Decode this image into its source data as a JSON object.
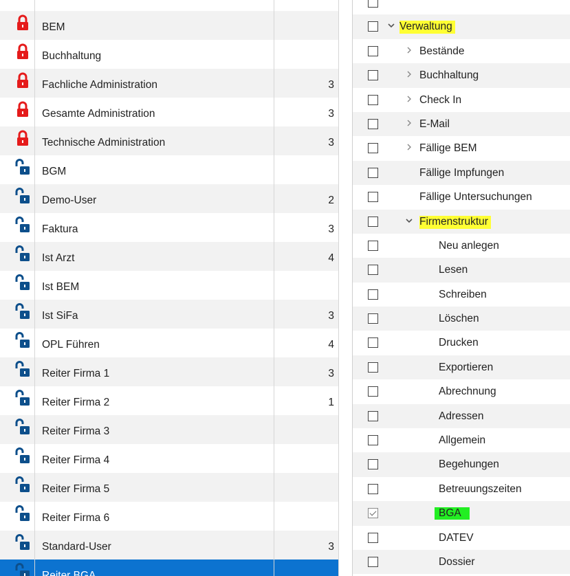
{
  "colors": {
    "selection": "#0c73d0",
    "lock_locked": "#e51b1b",
    "lock_unlocked": "#0d4f8b",
    "highlight_yellow": "#ffff33",
    "highlight_green": "#22ee22"
  },
  "roles": [
    {
      "name": "BEM",
      "count": "",
      "locked": true,
      "selected": false
    },
    {
      "name": "Buchhaltung",
      "count": "",
      "locked": true,
      "selected": false
    },
    {
      "name": "Fachliche Administration",
      "count": "3",
      "locked": true,
      "selected": false
    },
    {
      "name": "Gesamte Administration",
      "count": "3",
      "locked": true,
      "selected": false
    },
    {
      "name": "Technische Administration",
      "count": "3",
      "locked": true,
      "selected": false
    },
    {
      "name": "BGM",
      "count": "",
      "locked": false,
      "selected": false
    },
    {
      "name": "Demo-User",
      "count": "2",
      "locked": false,
      "selected": false
    },
    {
      "name": "Faktura",
      "count": "3",
      "locked": false,
      "selected": false
    },
    {
      "name": "Ist Arzt",
      "count": "4",
      "locked": false,
      "selected": false
    },
    {
      "name": "Ist BEM",
      "count": "",
      "locked": false,
      "selected": false
    },
    {
      "name": "Ist SiFa",
      "count": "3",
      "locked": false,
      "selected": false
    },
    {
      "name": "OPL Führen",
      "count": "4",
      "locked": false,
      "selected": false
    },
    {
      "name": "Reiter Firma 1",
      "count": "3",
      "locked": false,
      "selected": false
    },
    {
      "name": "Reiter Firma 2",
      "count": "1",
      "locked": false,
      "selected": false
    },
    {
      "name": "Reiter Firma 3",
      "count": "",
      "locked": false,
      "selected": false
    },
    {
      "name": "Reiter Firma 4",
      "count": "",
      "locked": false,
      "selected": false
    },
    {
      "name": "Reiter Firma 5",
      "count": "",
      "locked": false,
      "selected": false
    },
    {
      "name": "Reiter Firma 6",
      "count": "",
      "locked": false,
      "selected": false
    },
    {
      "name": "Standard-User",
      "count": "3",
      "locked": false,
      "selected": false
    },
    {
      "name": "Reiter BGA",
      "count": "",
      "locked": false,
      "selected": true
    }
  ],
  "permissions": [
    {
      "label": "",
      "level": 0,
      "expander": "none",
      "checked": false,
      "highlight": "none"
    },
    {
      "label": "Verwaltung",
      "level": 0,
      "expander": "expanded",
      "checked": false,
      "highlight": "yellow"
    },
    {
      "label": "Bestände",
      "level": 1,
      "expander": "collapsed",
      "checked": false,
      "highlight": "none"
    },
    {
      "label": "Buchhaltung",
      "level": 1,
      "expander": "collapsed",
      "checked": false,
      "highlight": "none"
    },
    {
      "label": "Check In",
      "level": 1,
      "expander": "collapsed",
      "checked": false,
      "highlight": "none"
    },
    {
      "label": "E-Mail",
      "level": 1,
      "expander": "collapsed",
      "checked": false,
      "highlight": "none"
    },
    {
      "label": "Fällige BEM",
      "level": 1,
      "expander": "collapsed",
      "checked": false,
      "highlight": "none"
    },
    {
      "label": "Fällige Impfungen",
      "level": 1,
      "expander": "none",
      "checked": false,
      "highlight": "none"
    },
    {
      "label": "Fällige Untersuchungen",
      "level": 1,
      "expander": "none",
      "checked": false,
      "highlight": "none"
    },
    {
      "label": "Firmenstruktur",
      "level": 1,
      "expander": "expanded",
      "checked": false,
      "highlight": "yellow"
    },
    {
      "label": "Neu anlegen",
      "level": 2,
      "expander": "none",
      "checked": false,
      "highlight": "none"
    },
    {
      "label": "Lesen",
      "level": 2,
      "expander": "none",
      "checked": false,
      "highlight": "none"
    },
    {
      "label": "Schreiben",
      "level": 2,
      "expander": "none",
      "checked": false,
      "highlight": "none"
    },
    {
      "label": "Löschen",
      "level": 2,
      "expander": "none",
      "checked": false,
      "highlight": "none"
    },
    {
      "label": "Drucken",
      "level": 2,
      "expander": "none",
      "checked": false,
      "highlight": "none"
    },
    {
      "label": "Exportieren",
      "level": 2,
      "expander": "none",
      "checked": false,
      "highlight": "none"
    },
    {
      "label": "Abrechnung",
      "level": 2,
      "expander": "none",
      "checked": false,
      "highlight": "none"
    },
    {
      "label": "Adressen",
      "level": 2,
      "expander": "none",
      "checked": false,
      "highlight": "none"
    },
    {
      "label": "Allgemein",
      "level": 2,
      "expander": "none",
      "checked": false,
      "highlight": "none"
    },
    {
      "label": "Begehungen",
      "level": 2,
      "expander": "none",
      "checked": false,
      "highlight": "none"
    },
    {
      "label": "Betreuungszeiten",
      "level": 2,
      "expander": "none",
      "checked": false,
      "highlight": "none"
    },
    {
      "label": "BGA",
      "level": 2,
      "expander": "none",
      "checked": true,
      "highlight": "green"
    },
    {
      "label": "DATEV",
      "level": 2,
      "expander": "none",
      "checked": false,
      "highlight": "none"
    },
    {
      "label": "Dossier",
      "level": 2,
      "expander": "none",
      "checked": false,
      "highlight": "none"
    }
  ]
}
